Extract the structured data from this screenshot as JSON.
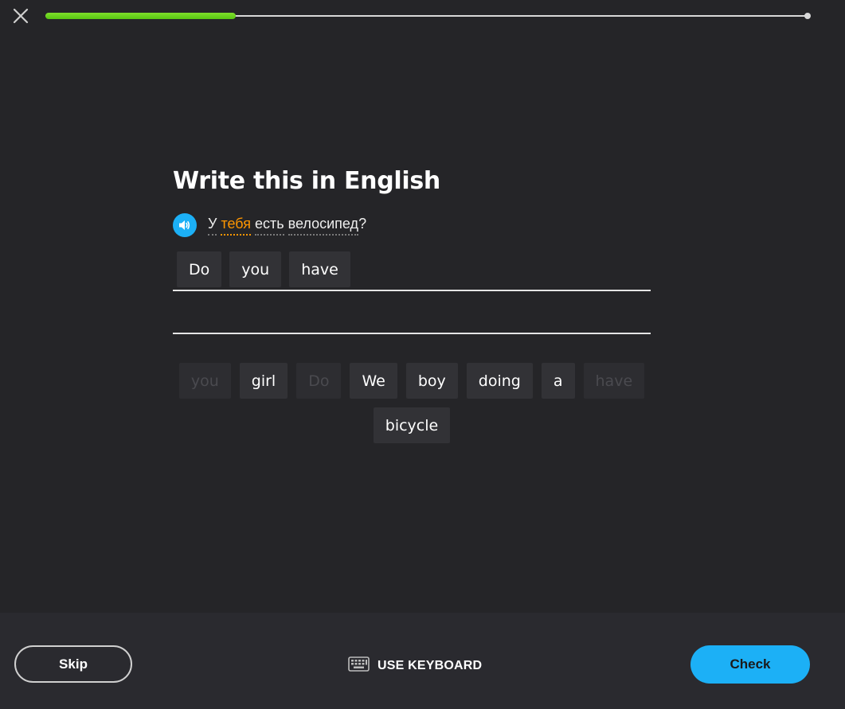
{
  "header": {
    "close_icon": "close-icon",
    "progress": 0.25
  },
  "challenge": {
    "title": "Write this in English",
    "speaker_icon": "speaker-icon",
    "sentence": {
      "word1": "У",
      "word2": "тебя",
      "word3": "есть",
      "word4": "велосипед",
      "punct": "?"
    },
    "answer_tiles": [
      "Do",
      "you",
      "have"
    ],
    "word_bank": [
      {
        "label": "you",
        "state": "used"
      },
      {
        "label": "girl",
        "state": "available"
      },
      {
        "label": "Do",
        "state": "used"
      },
      {
        "label": "We",
        "state": "available"
      },
      {
        "label": "boy",
        "state": "available"
      },
      {
        "label": "doing",
        "state": "available"
      },
      {
        "label": "a",
        "state": "available"
      },
      {
        "label": "have",
        "state": "used"
      },
      {
        "label": "bicycle",
        "state": "available"
      }
    ]
  },
  "footer": {
    "skip_label": "Skip",
    "keyboard_icon": "keyboard-icon",
    "keyboard_label": "USE KEYBOARD",
    "check_label": "Check"
  },
  "colors": {
    "background": "#252528",
    "footer_bg": "#2a2a2f",
    "accent_blue": "#1cb0f6",
    "progress_green": "#58c512",
    "highlight_orange": "#ff9600"
  }
}
